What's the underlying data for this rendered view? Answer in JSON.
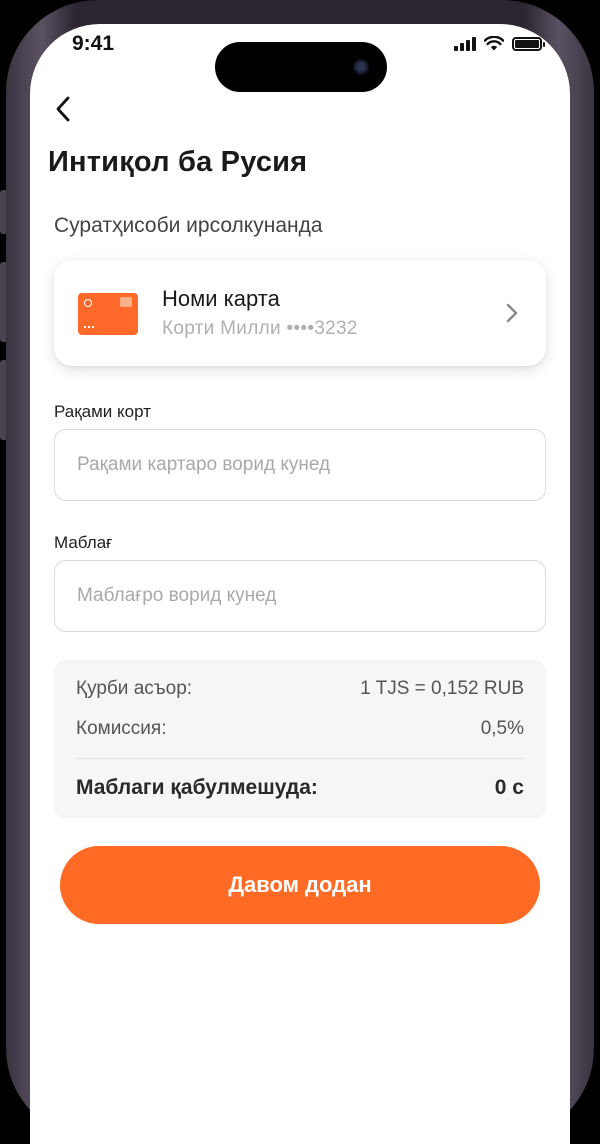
{
  "status_bar": {
    "time": "9:41"
  },
  "page": {
    "title": "Интиқол ба Русия"
  },
  "sender": {
    "section_label": "Суратҳисоби ирсолкунанда",
    "card_name": "Номи карта",
    "card_sub": "Корти Милли ••••3232"
  },
  "card_number": {
    "label": "Рақами корт",
    "placeholder": "Рақами картаро ворид кунед"
  },
  "amount": {
    "label": "Маблағ",
    "placeholder": "Маблағро ворид кунед"
  },
  "summary": {
    "rate_label": "Қурби асъор:",
    "rate_value": "1 TJS = 0,152 RUB",
    "fee_label": "Комиссия:",
    "fee_value": "0,5%",
    "total_label": "Маблаги қабулмешуда:",
    "total_value": "0 с"
  },
  "actions": {
    "continue_label": "Давом додан"
  },
  "colors": {
    "accent": "#ff6a25",
    "card": "#ff6a2a"
  }
}
